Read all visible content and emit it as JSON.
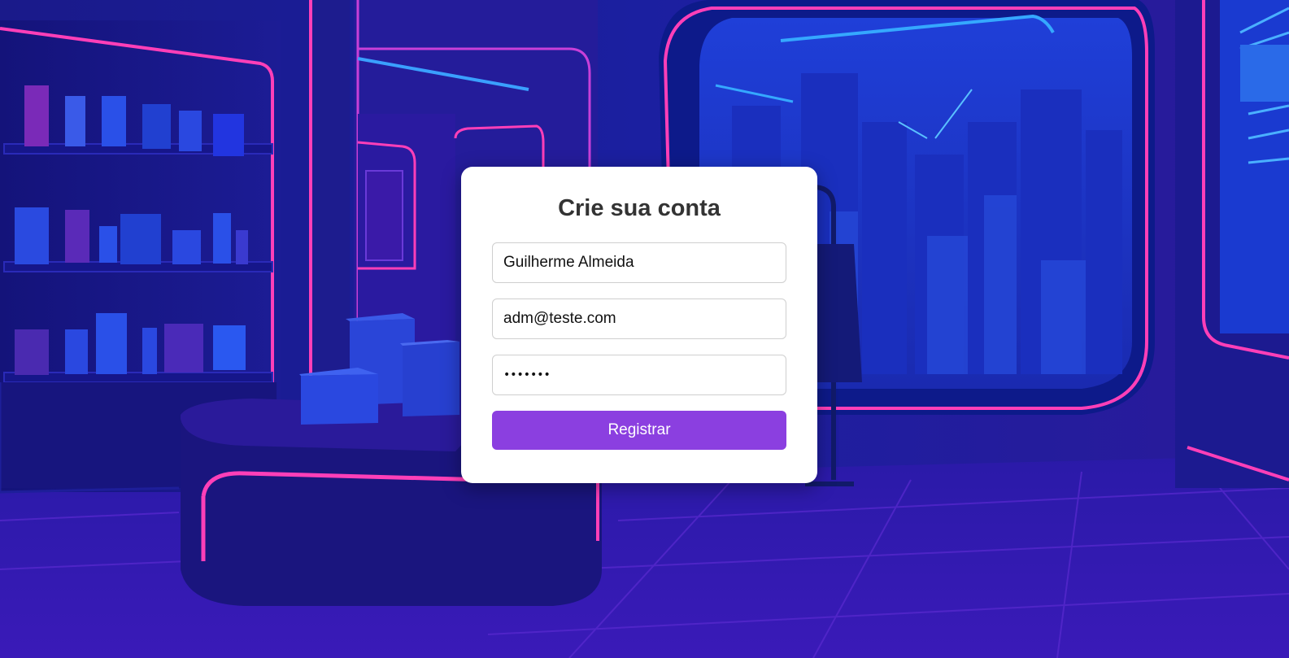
{
  "form": {
    "title": "Crie sua conta",
    "name_value": "Guilherme Almeida",
    "email_value": "adm@teste.com",
    "password_mask": "•••••••",
    "submit_label": "Registrar"
  },
  "colors": {
    "button": "#8b3fe0",
    "card": "#ffffff",
    "title": "#333333",
    "neon_pink": "#ff3fb8",
    "neon_blue": "#2f8cff",
    "background_deep": "#0b0f6e"
  }
}
